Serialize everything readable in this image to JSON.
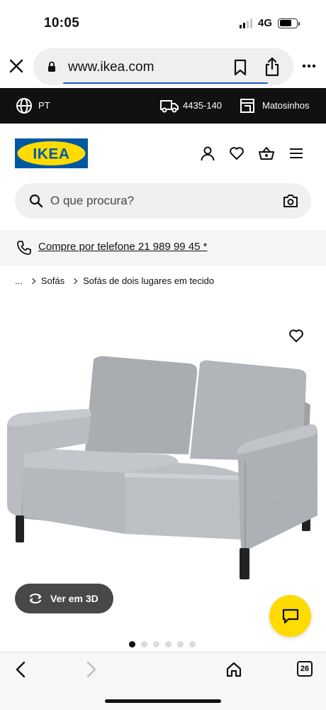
{
  "status_bar": {
    "time": "10:05",
    "network": "4G",
    "signal_bars_active": 2,
    "signal_bars_total": 4,
    "battery_level": 0.7
  },
  "browser": {
    "url": "www.ikea.com",
    "icons": [
      "close-icon",
      "lock-icon",
      "bookmark-icon",
      "share-icon",
      "more-icon"
    ]
  },
  "top_strip": {
    "language": "PT",
    "postal_code": "4435-140",
    "store": "Matosinhos"
  },
  "header": {
    "logo_text": "IKEA",
    "icons": [
      "user-icon",
      "heart-icon",
      "basket-icon",
      "menu-icon"
    ]
  },
  "search": {
    "placeholder": "O que procura?"
  },
  "phone_banner": {
    "text": "Compre por telefone 21 989 99 45 *"
  },
  "breadcrumb": {
    "ellipsis": "...",
    "items": [
      "Sofás",
      "Sofás de dois lugares em tecido"
    ]
  },
  "product": {
    "view_3d_label": "Ver em 3D",
    "carousel_total": 6,
    "carousel_active": 1
  },
  "bottom_nav": {
    "tab_count": "26"
  },
  "colors": {
    "brand_blue": "#0058a3",
    "brand_yellow": "#ffdb00",
    "dark_strip": "#111111",
    "sofa_gray": "#b5b9be"
  }
}
